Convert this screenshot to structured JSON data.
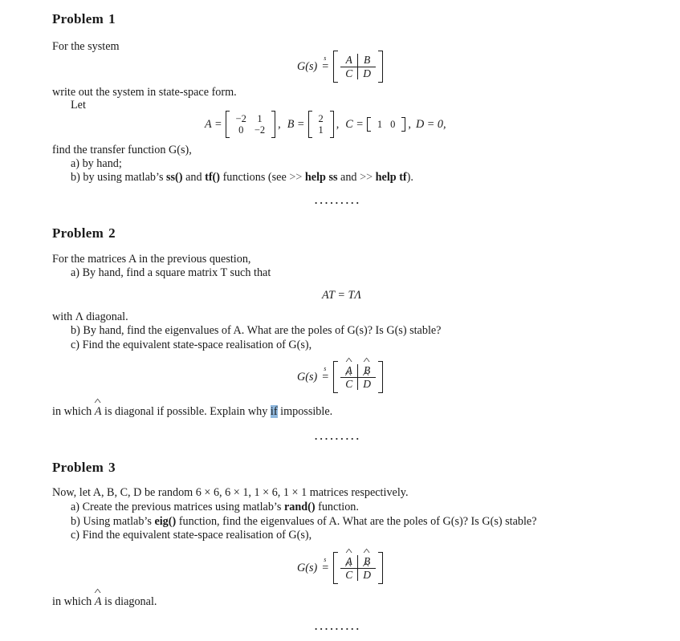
{
  "problems": [
    {
      "title": "Problem",
      "number": "1",
      "intro": "For the system",
      "line_state_space": "write out the system in state-space form.",
      "let": "Let",
      "block_matrix": {
        "lhs": "G(s)",
        "cells": [
          "A",
          "B",
          "C",
          "D"
        ]
      },
      "matrices": {
        "A_label": "A =",
        "A": [
          [
            "−2",
            "1"
          ],
          [
            "0",
            "−2"
          ]
        ],
        "B_label": "B =",
        "B": [
          [
            "2"
          ],
          [
            "1"
          ]
        ],
        "C_label": "C =",
        "C": [
          [
            "1",
            "0"
          ]
        ],
        "D_text": "D = 0,"
      },
      "find_line": "find the transfer function G(s),",
      "items": [
        {
          "label": "a) by hand;"
        },
        {
          "prefix": "b) by using matlab’s ",
          "fn1": "ss()",
          "mid": " and ",
          "fn2": "tf()",
          "mid2": " functions (see ",
          "cmd1_prompt": ">>",
          "cmd1": "help ss",
          "and": " and ",
          "cmd2_prompt": ">>",
          "cmd2": "help tf",
          "suffix": ")."
        }
      ],
      "separator": "........."
    },
    {
      "title": "Problem",
      "number": "2",
      "intro": "For the matrices A in the previous question,",
      "item_a": "a) By hand, find a square matrix T such that",
      "equation": "AT = TΛ",
      "with_line": "with Λ diagonal.",
      "item_b": "b) By hand, find the eigenvalues of A. What are the poles of G(s)? Is G(s) stable?",
      "item_c": "c) Find the equivalent state-space realisation of G(s),",
      "block_matrix": {
        "lhs": "G(s)",
        "cells": [
          "A",
          "B",
          "C",
          "D"
        ],
        "hatted": true
      },
      "closing_pre": "in which ",
      "closing_var": "A",
      "closing_mid": " is diagonal if possible. Explain why ",
      "closing_sel": "if",
      "closing_end": " impossible.",
      "separator": "........."
    },
    {
      "title": "Problem",
      "number": "3",
      "intro": "Now, let A, B, C, D be random 6 × 6, 6 × 1, 1 × 6, 1 × 1 matrices respectively.",
      "item_a_pre": "a) Create the previous matrices using matlab’s ",
      "item_a_fn": "rand()",
      "item_a_post": " function.",
      "item_b_pre": "b) Using matlab’s ",
      "item_b_fn": "eig()",
      "item_b_post": " function, find the eigenvalues of A. What are the poles of G(s)? Is G(s) stable?",
      "item_c": "c) Find the equivalent state-space realisation of G(s),",
      "block_matrix": {
        "lhs": "G(s)",
        "cells": [
          "A",
          "B",
          "C",
          "D"
        ],
        "hatted": true
      },
      "closing_pre": "in which ",
      "closing_var": "A",
      "closing_end": " is diagonal.",
      "separator": "........."
    }
  ],
  "symbols": {
    "eq_s": "s",
    "equals": "="
  }
}
